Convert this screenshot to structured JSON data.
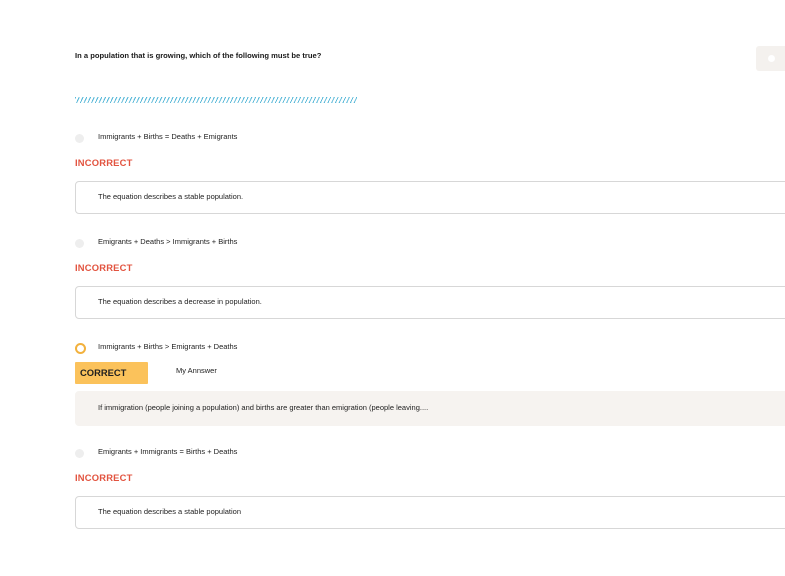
{
  "question": "In a population that is growing, which of the following must be true?",
  "options": [
    {
      "label": "Immigrants + Births = Deaths + Emigrants",
      "status": "INCORRECT",
      "feedback": "The equation describes a stable population."
    },
    {
      "label": "Emigrants + Deaths > Immigrants + Births",
      "status": "INCORRECT",
      "feedback": "The equation describes a decrease in population."
    },
    {
      "label": "Immigrants + Births > Emigrants + Deaths",
      "status": "CORRECT",
      "tag": "My Annswer",
      "feedback": "If immigration (people joining a population) and births are greater than emigration (people leaving...."
    },
    {
      "label": "Emigrants + Immigrants =  Births + Deaths",
      "status": "INCORRECT",
      "feedback": "The equation describes a stable population"
    }
  ],
  "colors": {
    "incorrect": "#e2533f",
    "correct_badge": "#fbc25b",
    "selected_radio": "#f2b13d",
    "stripe": "#58b8d8"
  }
}
